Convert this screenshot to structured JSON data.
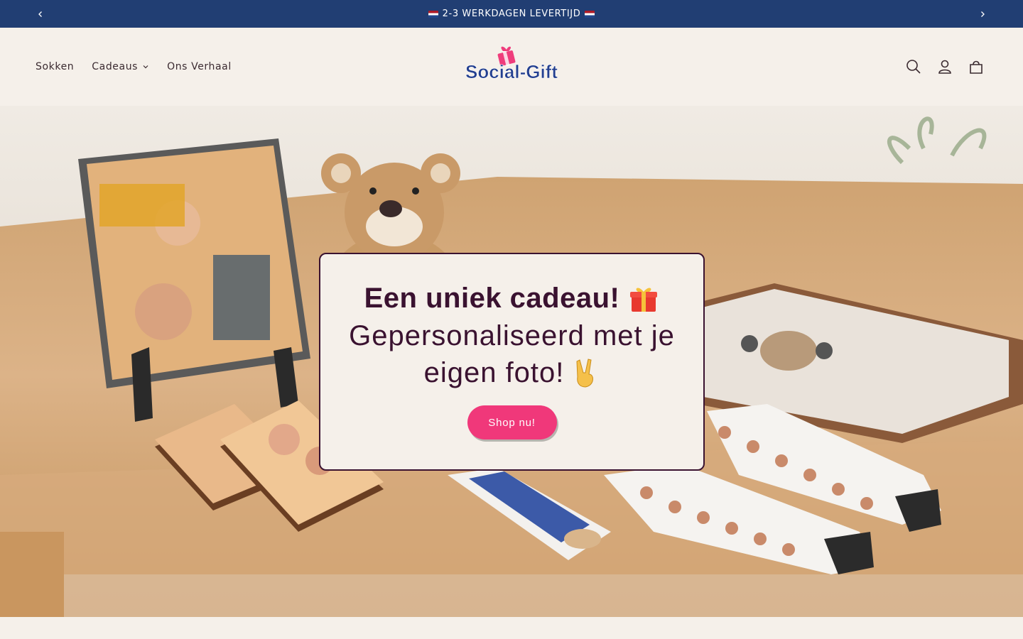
{
  "announcement": {
    "text": "2-3 WERKDAGEN LEVERTIJD",
    "prev_icon": "chevron-left-icon",
    "next_icon": "chevron-right-icon"
  },
  "header": {
    "nav": {
      "sokken": "Sokken",
      "cadeaus": "Cadeaus",
      "ons_verhaal": "Ons Verhaal"
    },
    "logo_text": "Social-Gift",
    "icons": [
      "search-icon",
      "account-icon",
      "cart-icon"
    ]
  },
  "hero": {
    "title": "Een uniek cadeau!",
    "subtitle_line1": "Gepersonaliseerd met je",
    "subtitle_line2": "eigen foto!",
    "cta_label": "Shop nu!"
  },
  "colors": {
    "announcement_bg": "#213e73",
    "page_bg": "#f5f0ea",
    "text_dark": "#3a1230",
    "cta_pink": "#f0387a",
    "logo_blue": "#233f8f",
    "logo_pink": "#ef3d7c"
  }
}
